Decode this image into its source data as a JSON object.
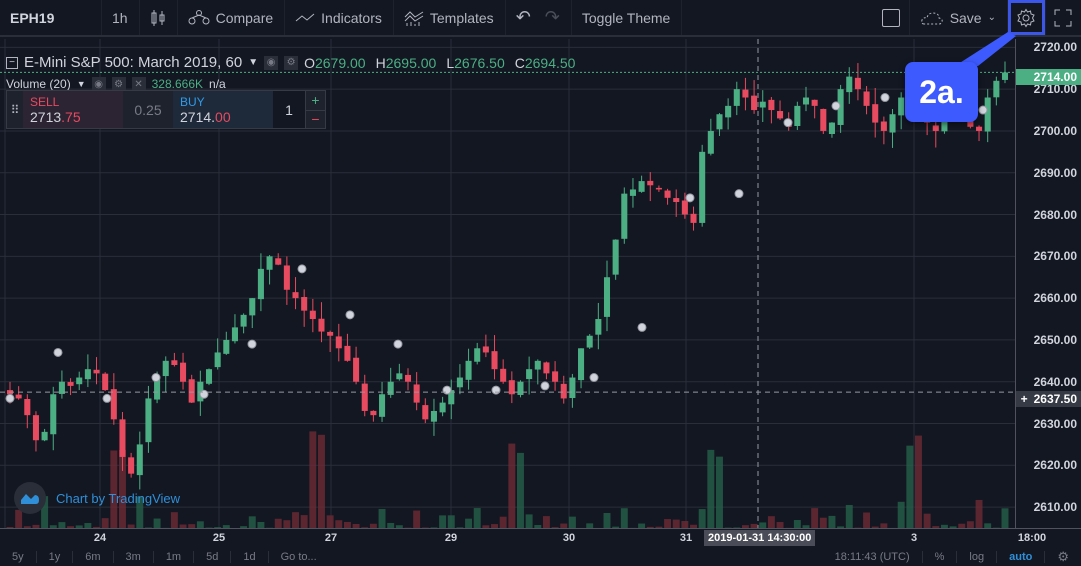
{
  "toolbar": {
    "symbol": "EPH19",
    "interval": "1h",
    "compare_label": "Compare",
    "indicators_label": "Indicators",
    "templates_label": "Templates",
    "toggle_theme_label": "Toggle Theme",
    "save_label": "Save"
  },
  "legend": {
    "title": "E-Mini S&P 500: March 2019, 60",
    "ohlc": [
      {
        "key": "O",
        "value": "2679.00"
      },
      {
        "key": "H",
        "value": "2695.00"
      },
      {
        "key": "L",
        "value": "2676.50"
      },
      {
        "key": "C",
        "value": "2694.50"
      }
    ],
    "volume_label": "Volume (20)",
    "volume_value": "328.666K",
    "volume_ma": "n/a"
  },
  "trade_panel": {
    "sell_label": "SELL",
    "sell_price_main": "2713",
    "sell_price_frac": ".75",
    "spread": "0.25",
    "buy_label": "BUY",
    "buy_price_main": "2714.",
    "buy_price_frac": "00",
    "quantity": "1",
    "plus": "+",
    "minus": "−"
  },
  "callout": {
    "text": "2a.",
    "color": "#3d5afe"
  },
  "watermark": "Chart by TradingView",
  "price_axis": {
    "ticks": [
      "2720.00",
      "2710.00",
      "2700.00",
      "2690.00",
      "2680.00",
      "2670.00",
      "2660.00",
      "2650.00",
      "2640.00",
      "2630.00",
      "2620.00",
      "2610.00"
    ],
    "last_price": "2714.00",
    "crosshair_price": "2637.50"
  },
  "time_axis": {
    "ticks": [
      "24",
      "25",
      "27",
      "29",
      "30",
      "31",
      "3",
      "18:00"
    ],
    "crosshair_time": "2019-01-31 14:30:00"
  },
  "bottom_bar": {
    "ranges": [
      "5y",
      "1y",
      "6m",
      "3m",
      "1m",
      "5d",
      "1d"
    ],
    "goto": "Go to...",
    "clock": "18:11:43 (UTC)",
    "percent": "%",
    "log": "log",
    "auto": "auto"
  },
  "colors": {
    "up": "#4caf84",
    "down": "#e84a5f",
    "accent": "#3d5afe",
    "auto": "#2f8fd8"
  },
  "chart_data": {
    "type": "candlestick",
    "title": "E-Mini S&P 500: March 2019, 60",
    "ylim": [
      2605,
      2722
    ],
    "closes": [
      2637,
      2636,
      2632,
      2626,
      2628,
      2637,
      2640,
      2639,
      2641,
      2643,
      2642,
      2638,
      2631,
      2622,
      2618,
      2625,
      2636,
      2641,
      2645,
      2644,
      2640,
      2635,
      2640,
      2643,
      2647,
      2650,
      2653,
      2656,
      2660,
      2667,
      2670,
      2668,
      2662,
      2660,
      2657,
      2655,
      2652,
      2651,
      2648,
      2645,
      2640,
      2633,
      2632,
      2637,
      2640,
      2642,
      2640,
      2635,
      2631,
      2633,
      2635,
      2638,
      2641,
      2645,
      2648,
      2647,
      2643,
      2640,
      2637,
      2640,
      2643,
      2645,
      2642,
      2640,
      2636,
      2641,
      2648,
      2651,
      2655,
      2665,
      2674,
      2685,
      2686,
      2688,
      2687,
      2686,
      2684,
      2683,
      2680,
      2678,
      2695,
      2700,
      2704,
      2706,
      2710,
      2708,
      2705,
      2707,
      2705,
      2703,
      2701,
      2706,
      2708,
      2706,
      2700,
      2702,
      2710,
      2713,
      2710,
      2706,
      2702,
      2700,
      2704,
      2708,
      2710,
      2706,
      2702,
      2700,
      2705,
      2708,
      2704,
      2701,
      2700,
      2708,
      2712,
      2714
    ]
  }
}
